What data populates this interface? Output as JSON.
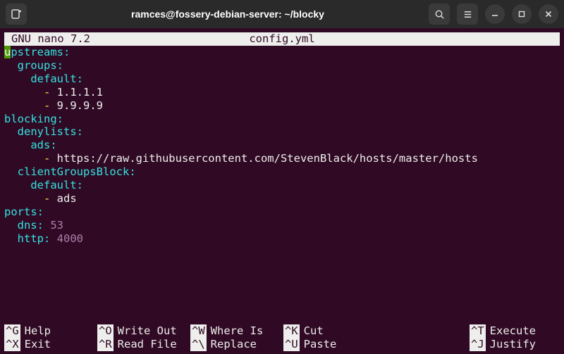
{
  "window": {
    "title": "ramces@fossery-debian-server: ~/blocky"
  },
  "nano": {
    "header": {
      "app": "GNU nano 7.2",
      "file": "config.yml"
    },
    "lines": [
      [
        {
          "t": "upstreams",
          "c": "key",
          "cursor_first": true
        },
        {
          "t": ":",
          "c": "key"
        }
      ],
      [
        {
          "t": "  ",
          "c": "plain"
        },
        {
          "t": "groups",
          "c": "key"
        },
        {
          "t": ":",
          "c": "key"
        }
      ],
      [
        {
          "t": "    ",
          "c": "plain"
        },
        {
          "t": "default",
          "c": "key"
        },
        {
          "t": ":",
          "c": "key"
        }
      ],
      [
        {
          "t": "      ",
          "c": "plain"
        },
        {
          "t": "- ",
          "c": "dash"
        },
        {
          "t": "1.1.1.1",
          "c": "plain"
        }
      ],
      [
        {
          "t": "      ",
          "c": "plain"
        },
        {
          "t": "- ",
          "c": "dash"
        },
        {
          "t": "9.9.9.9",
          "c": "plain"
        }
      ],
      [
        {
          "t": "blocking",
          "c": "key"
        },
        {
          "t": ":",
          "c": "key"
        }
      ],
      [
        {
          "t": "  ",
          "c": "plain"
        },
        {
          "t": "denylists",
          "c": "key"
        },
        {
          "t": ":",
          "c": "key"
        }
      ],
      [
        {
          "t": "    ",
          "c": "plain"
        },
        {
          "t": "ads",
          "c": "key"
        },
        {
          "t": ":",
          "c": "key"
        }
      ],
      [
        {
          "t": "      ",
          "c": "plain"
        },
        {
          "t": "- ",
          "c": "dash"
        },
        {
          "t": "https://raw.githubusercontent.com/StevenBlack/hosts/master/hosts",
          "c": "plain"
        }
      ],
      [
        {
          "t": "  ",
          "c": "plain"
        },
        {
          "t": "clientGroupsBlock",
          "c": "key"
        },
        {
          "t": ":",
          "c": "key"
        }
      ],
      [
        {
          "t": "    ",
          "c": "plain"
        },
        {
          "t": "default",
          "c": "key"
        },
        {
          "t": ":",
          "c": "key"
        }
      ],
      [
        {
          "t": "      ",
          "c": "plain"
        },
        {
          "t": "- ",
          "c": "dash"
        },
        {
          "t": "ads",
          "c": "plain"
        }
      ],
      [
        {
          "t": "ports",
          "c": "key"
        },
        {
          "t": ":",
          "c": "key"
        }
      ],
      [
        {
          "t": "  ",
          "c": "plain"
        },
        {
          "t": "dns",
          "c": "key"
        },
        {
          "t": ": ",
          "c": "key"
        },
        {
          "t": "53",
          "c": "val-str"
        }
      ],
      [
        {
          "t": "  ",
          "c": "plain"
        },
        {
          "t": "http",
          "c": "key"
        },
        {
          "t": ": ",
          "c": "key"
        },
        {
          "t": "4000",
          "c": "val-str"
        }
      ]
    ],
    "footer": [
      {
        "key": "^G",
        "label": "Help"
      },
      {
        "key": "^O",
        "label": "Write Out"
      },
      {
        "key": "^W",
        "label": "Where Is"
      },
      {
        "key": "^K",
        "label": "Cut"
      },
      {
        "key": "^T",
        "label": "Execute"
      },
      {
        "key": "^X",
        "label": "Exit"
      },
      {
        "key": "^R",
        "label": "Read File"
      },
      {
        "key": "^\\",
        "label": "Replace"
      },
      {
        "key": "^U",
        "label": "Paste"
      },
      {
        "key": "^J",
        "label": "Justify"
      }
    ]
  }
}
